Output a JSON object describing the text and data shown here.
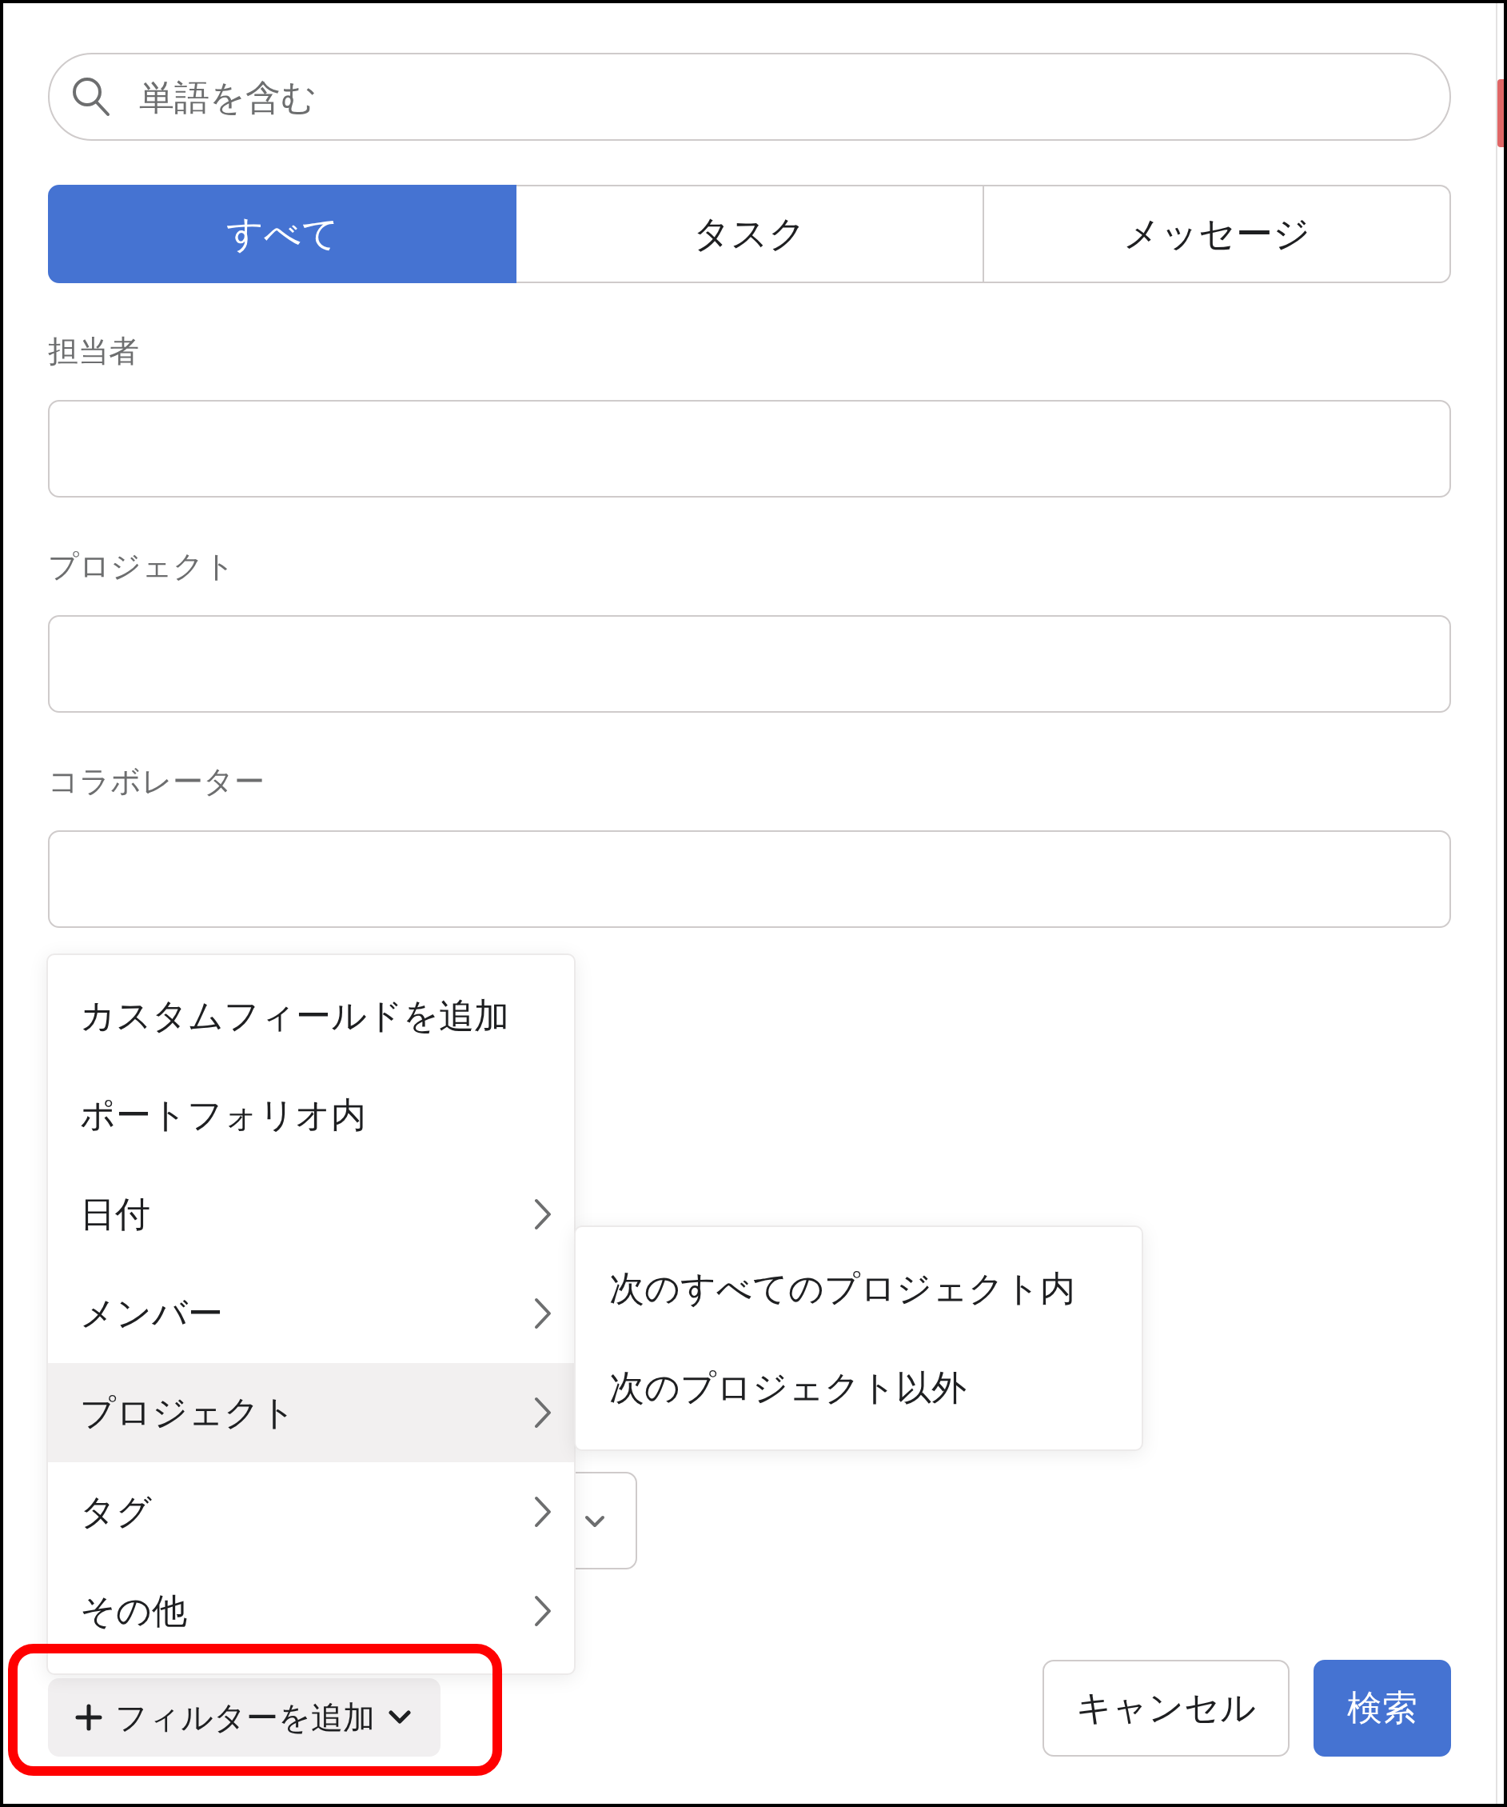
{
  "search": {
    "placeholder": "単語を含む"
  },
  "tabs": [
    {
      "label": "すべて",
      "selected": true
    },
    {
      "label": "タスク",
      "selected": false
    },
    {
      "label": "メッセージ",
      "selected": false
    }
  ],
  "fields": [
    {
      "label": "担当者"
    },
    {
      "label": "プロジェクト"
    },
    {
      "label": "コラボレーター"
    }
  ],
  "filter_menu": {
    "items": [
      {
        "label": "カスタムフィールドを追加",
        "has_submenu": false,
        "selected": false
      },
      {
        "label": "ポートフォリオ内",
        "has_submenu": false,
        "selected": false
      },
      {
        "label": "日付",
        "has_submenu": true,
        "selected": false
      },
      {
        "label": "メンバー",
        "has_submenu": true,
        "selected": false
      },
      {
        "label": "プロジェクト",
        "has_submenu": true,
        "selected": true
      },
      {
        "label": "タグ",
        "has_submenu": true,
        "selected": false
      },
      {
        "label": "その他",
        "has_submenu": true,
        "selected": false
      }
    ]
  },
  "submenu": {
    "items": [
      {
        "label": "次のすべてのプロジェクト内"
      },
      {
        "label": "次のプロジェクト以外"
      }
    ]
  },
  "add_filter_button": {
    "label": "フィルターを追加"
  },
  "buttons": [
    {
      "label": "キャンセル",
      "kind": "secondary"
    },
    {
      "label": "検索",
      "kind": "primary"
    }
  ]
}
